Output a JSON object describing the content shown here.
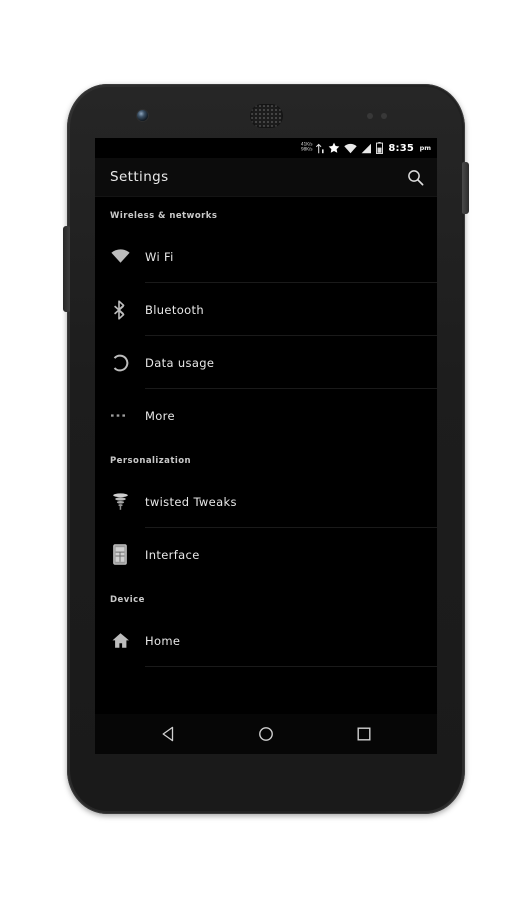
{
  "device": {
    "hardware": {
      "front_camera": "front-camera",
      "earpiece": "earpiece-speaker",
      "proximity_sensor": "proximity-sensor",
      "power_button": "power-button",
      "volume_button": "volume-rocker"
    }
  },
  "statusbar": {
    "data_rate_up": "41K/s",
    "data_rate_down": "98K/s",
    "icons": [
      "data-transfer-icon",
      "priority-star-icon",
      "wifi-icon",
      "cell-signal-icon",
      "battery-icon"
    ],
    "time": "8:35",
    "ampm": "pm"
  },
  "actionbar": {
    "title": "Settings",
    "search_icon": "search-icon"
  },
  "sections": [
    {
      "header": "Wireless & networks",
      "items": [
        {
          "label": "Wi Fi",
          "icon": "wifi-icon",
          "divider": true
        },
        {
          "label": "Bluetooth",
          "icon": "bluetooth-icon",
          "divider": true
        },
        {
          "label": "Data usage",
          "icon": "data-usage-icon",
          "divider": true
        },
        {
          "label": "More",
          "icon": "more-dots-icon",
          "divider": false
        }
      ]
    },
    {
      "header": "Personalization",
      "items": [
        {
          "label": "twisted Tweaks",
          "icon": "tornado-icon",
          "divider": true
        },
        {
          "label": "Interface",
          "icon": "interface-icon",
          "divider": false
        }
      ]
    },
    {
      "header": "Device",
      "items": [
        {
          "label": "Home",
          "icon": "home-icon",
          "divider": true
        }
      ]
    }
  ],
  "navbar": {
    "back": "back-triangle-icon",
    "home": "home-circle-icon",
    "recents": "recents-square-icon"
  },
  "colors": {
    "screen_bg": "#000000",
    "actionbar_bg": "#0c0c0c",
    "text_primary": "#e8e8e8",
    "text_header": "#c9c9c9",
    "divider": "#1a1a1a",
    "icon": "#bdbdbd",
    "phone_body": "#2b2b2b",
    "page_bg": "#ffffff"
  }
}
